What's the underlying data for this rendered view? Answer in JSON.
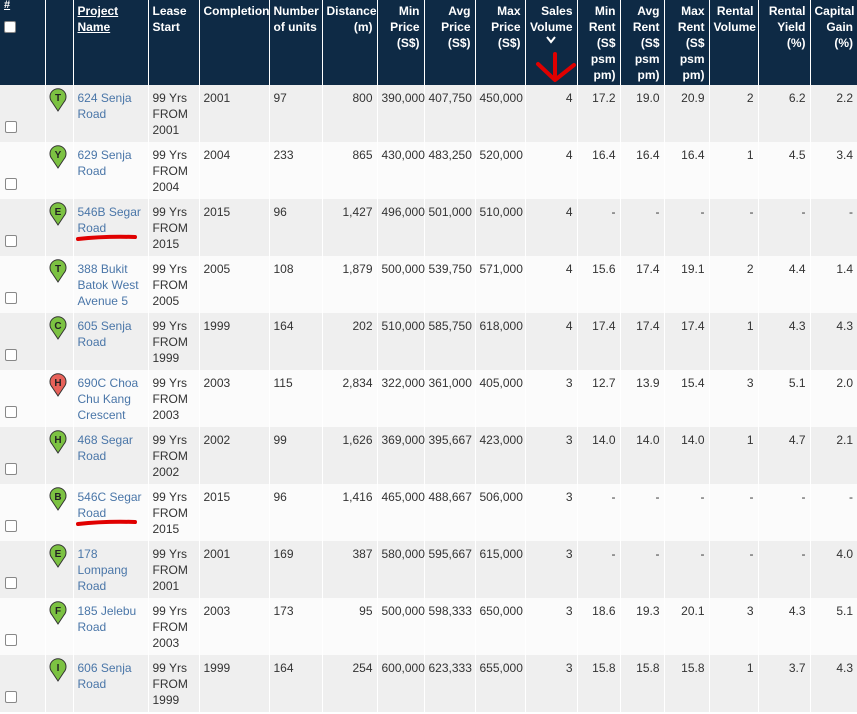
{
  "headers": {
    "hash": "#",
    "project_name": "Project Name",
    "lease_start": "Lease Start",
    "completion": "Completion",
    "number_of_units": "Number of units",
    "distance": "Distance (m)",
    "min_price": "Min Price (S$)",
    "avg_price": "Avg Price (S$)",
    "max_price": "Max Price (S$)",
    "sales_volume": "Sales Volume",
    "min_rent": "Min Rent (S$ psm pm)",
    "avg_rent": "Avg Rent (S$ psm pm)",
    "max_rent": "Max Rent (S$ psm pm)",
    "rental_volume": "Rental Volume",
    "rental_yield": "Rental Yield (%)",
    "capital_gain": "Capital Gain (%)"
  },
  "colors": {
    "header_bg": "#0e2a45",
    "link": "#4a76a8",
    "pin_green": "#7cc242",
    "pin_red": "#e8625a",
    "annotation_red": "#e00000"
  },
  "rows": [
    {
      "letter": "T",
      "pin": "green",
      "name": "624 Senja Road",
      "lease": "99 Yrs FROM 2001",
      "completion": "2001",
      "units": "97",
      "distance": "800",
      "min_price": "390,000",
      "avg_price": "407,750",
      "max_price": "450,000",
      "sales": "4",
      "min_rent": "17.2",
      "avg_rent": "19.0",
      "max_rent": "20.9",
      "rental_vol": "2",
      "yield": "6.2",
      "gain": "2.2",
      "underlined": false
    },
    {
      "letter": "Y",
      "pin": "green",
      "name": "629 Senja Road",
      "lease": "99 Yrs FROM 2004",
      "completion": "2004",
      "units": "233",
      "distance": "865",
      "min_price": "430,000",
      "avg_price": "483,250",
      "max_price": "520,000",
      "sales": "4",
      "min_rent": "16.4",
      "avg_rent": "16.4",
      "max_rent": "16.4",
      "rental_vol": "1",
      "yield": "4.5",
      "gain": "3.4",
      "underlined": false
    },
    {
      "letter": "E",
      "pin": "green",
      "name": "546B Segar Road",
      "lease": "99 Yrs FROM 2015",
      "completion": "2015",
      "units": "96",
      "distance": "1,427",
      "min_price": "496,000",
      "avg_price": "501,000",
      "max_price": "510,000",
      "sales": "4",
      "min_rent": "-",
      "avg_rent": "-",
      "max_rent": "-",
      "rental_vol": "-",
      "yield": "-",
      "gain": "-",
      "underlined": true
    },
    {
      "letter": "T",
      "pin": "green",
      "name": "388 Bukit Batok West Avenue 5",
      "lease": "99 Yrs FROM 2005",
      "completion": "2005",
      "units": "108",
      "distance": "1,879",
      "min_price": "500,000",
      "avg_price": "539,750",
      "max_price": "571,000",
      "sales": "4",
      "min_rent": "15.6",
      "avg_rent": "17.4",
      "max_rent": "19.1",
      "rental_vol": "2",
      "yield": "4.4",
      "gain": "1.4",
      "underlined": false
    },
    {
      "letter": "C",
      "pin": "green",
      "name": "605 Senja Road",
      "lease": "99 Yrs FROM 1999",
      "completion": "1999",
      "units": "164",
      "distance": "202",
      "min_price": "510,000",
      "avg_price": "585,750",
      "max_price": "618,000",
      "sales": "4",
      "min_rent": "17.4",
      "avg_rent": "17.4",
      "max_rent": "17.4",
      "rental_vol": "1",
      "yield": "4.3",
      "gain": "4.3",
      "underlined": false
    },
    {
      "letter": "H",
      "pin": "red",
      "name": "690C Choa Chu Kang Crescent",
      "lease": "99 Yrs FROM 2003",
      "completion": "2003",
      "units": "115",
      "distance": "2,834",
      "min_price": "322,000",
      "avg_price": "361,000",
      "max_price": "405,000",
      "sales": "3",
      "min_rent": "12.7",
      "avg_rent": "13.9",
      "max_rent": "15.4",
      "rental_vol": "3",
      "yield": "5.1",
      "gain": "2.0",
      "underlined": false
    },
    {
      "letter": "H",
      "pin": "green",
      "name": "468 Segar Road",
      "lease": "99 Yrs FROM 2002",
      "completion": "2002",
      "units": "99",
      "distance": "1,626",
      "min_price": "369,000",
      "avg_price": "395,667",
      "max_price": "423,000",
      "sales": "3",
      "min_rent": "14.0",
      "avg_rent": "14.0",
      "max_rent": "14.0",
      "rental_vol": "1",
      "yield": "4.7",
      "gain": "2.1",
      "underlined": false
    },
    {
      "letter": "B",
      "pin": "green",
      "name": "546C Segar Road",
      "lease": "99 Yrs FROM 2015",
      "completion": "2015",
      "units": "96",
      "distance": "1,416",
      "min_price": "465,000",
      "avg_price": "488,667",
      "max_price": "506,000",
      "sales": "3",
      "min_rent": "-",
      "avg_rent": "-",
      "max_rent": "-",
      "rental_vol": "-",
      "yield": "-",
      "gain": "-",
      "underlined": true
    },
    {
      "letter": "E",
      "pin": "green",
      "name": "178 Lompang Road",
      "lease": "99 Yrs FROM 2001",
      "completion": "2001",
      "units": "169",
      "distance": "387",
      "min_price": "580,000",
      "avg_price": "595,667",
      "max_price": "615,000",
      "sales": "3",
      "min_rent": "-",
      "avg_rent": "-",
      "max_rent": "-",
      "rental_vol": "-",
      "yield": "-",
      "gain": "4.0",
      "underlined": false
    },
    {
      "letter": "F",
      "pin": "green",
      "name": "185 Jelebu Road",
      "lease": "99 Yrs FROM 2003",
      "completion": "2003",
      "units": "173",
      "distance": "95",
      "min_price": "500,000",
      "avg_price": "598,333",
      "max_price": "650,000",
      "sales": "3",
      "min_rent": "18.6",
      "avg_rent": "19.3",
      "max_rent": "20.1",
      "rental_vol": "3",
      "yield": "4.3",
      "gain": "5.1",
      "underlined": false
    },
    {
      "letter": "I",
      "pin": "green",
      "name": "606 Senja Road",
      "lease": "99 Yrs FROM 1999",
      "completion": "1999",
      "units": "164",
      "distance": "254",
      "min_price": "600,000",
      "avg_price": "623,333",
      "max_price": "655,000",
      "sales": "3",
      "min_rent": "15.8",
      "avg_rent": "15.8",
      "max_rent": "15.8",
      "rental_vol": "1",
      "yield": "3.7",
      "gain": "4.3",
      "underlined": false
    }
  ]
}
